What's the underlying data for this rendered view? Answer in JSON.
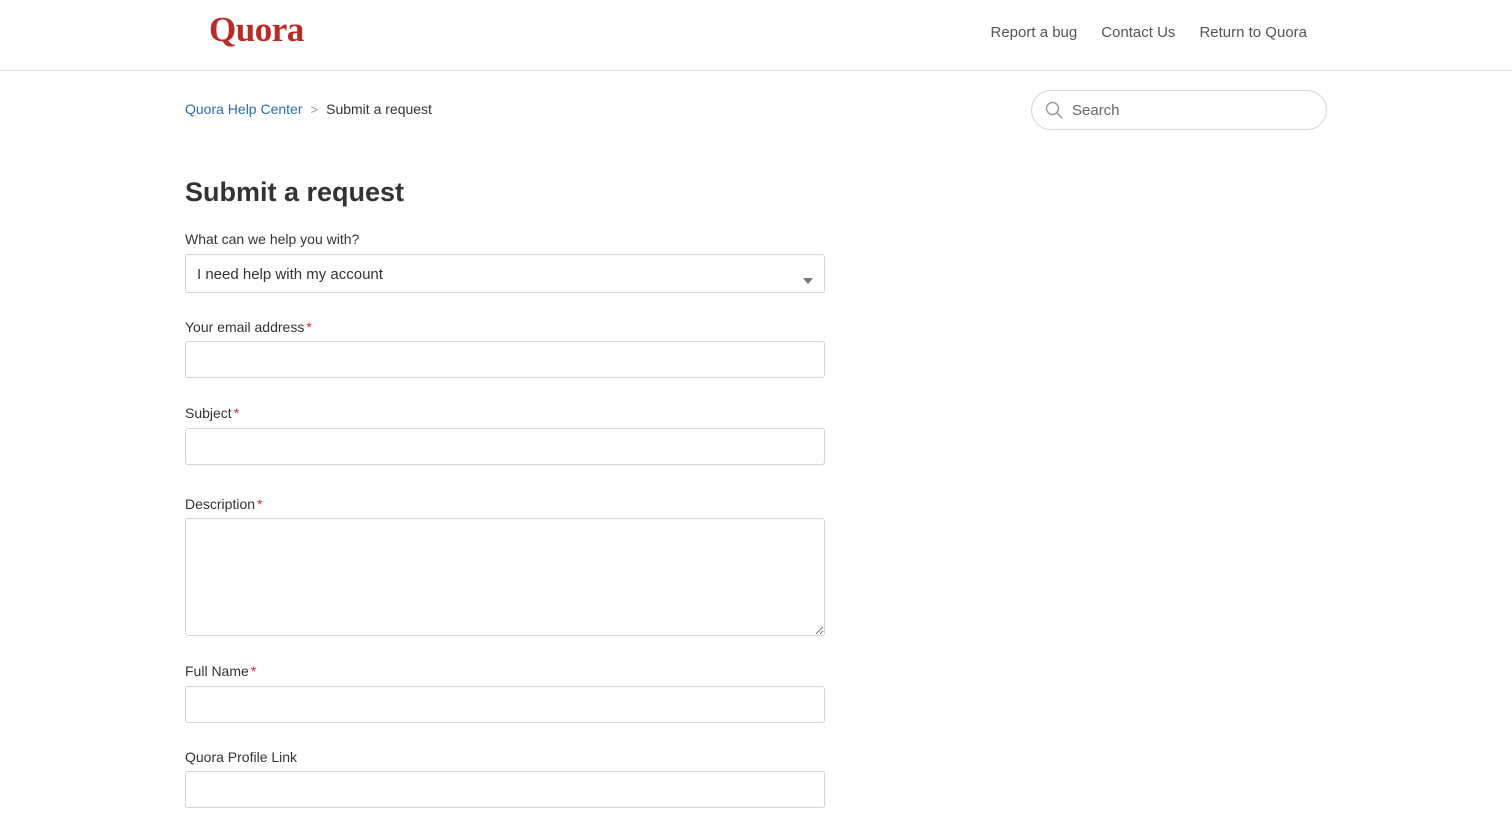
{
  "header": {
    "logo_text": "Quora",
    "nav": [
      {
        "label": "Report a bug"
      },
      {
        "label": "Contact Us"
      },
      {
        "label": "Return to Quora"
      }
    ]
  },
  "breadcrumb": {
    "home": "Quora Help Center",
    "separator": ">",
    "current": "Submit a request"
  },
  "search": {
    "placeholder": "Search",
    "value": ""
  },
  "page": {
    "title": "Submit a request"
  },
  "form": {
    "help_topic": {
      "label": "What can we help you with?",
      "selected": "I need help with my account"
    },
    "email": {
      "label": "Your email address",
      "required_mark": "*",
      "value": ""
    },
    "subject": {
      "label": "Subject",
      "required_mark": "*",
      "value": ""
    },
    "description": {
      "label": "Description",
      "required_mark": "*",
      "value": ""
    },
    "full_name": {
      "label": "Full Name",
      "required_mark": "*",
      "value": ""
    },
    "profile_link": {
      "label": "Quora Profile Link",
      "value": ""
    }
  },
  "colors": {
    "brand": "#b92b27",
    "link": "#2b6dad",
    "required": "#e0242e",
    "border": "#d3d3d3"
  },
  "icons": {
    "search": "search-icon",
    "dropdown": "caret-down-icon"
  }
}
